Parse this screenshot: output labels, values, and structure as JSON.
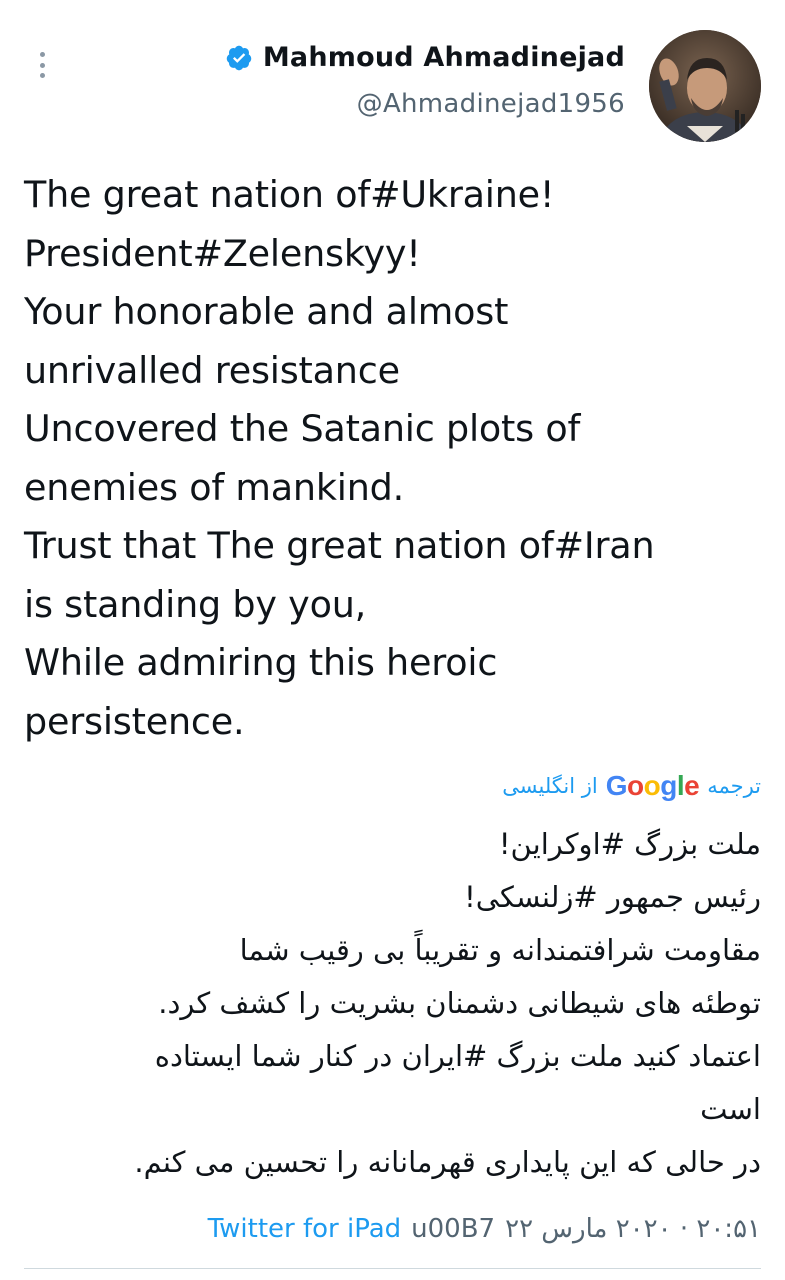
{
  "header": {
    "display_name": "Mahmoud Ahmadinejad",
    "handle": "@Ahmadinejad1956",
    "verified": true,
    "more_icon": "more-vertical-icon",
    "avatar_icon": "profile-photo"
  },
  "tweet": {
    "lines": [
      "The great nation of#Ukraine!",
      "President#Zelenskyy!",
      "Your honorable and almost",
      "unrivalled resistance",
      "Uncovered the Satanic plots of",
      "enemies of mankind.",
      "Trust that The great nation of#Iran",
      "is standing by you,",
      "While admiring this heroic",
      "persistence."
    ]
  },
  "translation": {
    "prefix": "ترجمه",
    "provider": "Google",
    "suffix": "از انگلیسی",
    "lines": [
      "ملت بزرگ #اوکراین!",
      "رئیس جمهور #زلنسکی!",
      "مقاومت شرافتمندانه و تقریباً بی رقیب شما",
      "توطئه های شیطانی دشمنان بشریت را کشف کرد.",
      "اعتماد کنید ملت بزرگ #ایران در کنار شما ایستاده",
      "است",
      "در حالی که این پایداری قهرمانانه را تحسین می کنم."
    ]
  },
  "meta": {
    "timestamp": "۲۰:۵۱ · ۲۰۲۰ مارس ۲۲",
    "separator": "u00B7",
    "source": "Twitter for iPad"
  },
  "colors": {
    "link": "#1d9bf0",
    "muted": "#536471",
    "text": "#0f1419",
    "verified": "#1d9bf0"
  }
}
